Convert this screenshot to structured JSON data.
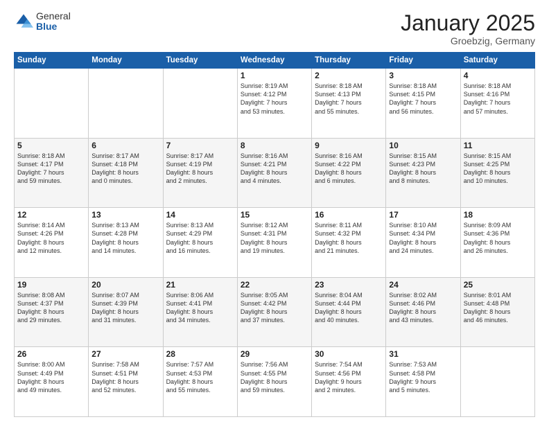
{
  "header": {
    "logo_general": "General",
    "logo_blue": "Blue",
    "month_title": "January 2025",
    "location": "Groebzig, Germany"
  },
  "weekdays": [
    "Sunday",
    "Monday",
    "Tuesday",
    "Wednesday",
    "Thursday",
    "Friday",
    "Saturday"
  ],
  "weeks": [
    [
      {
        "day": "",
        "info": ""
      },
      {
        "day": "",
        "info": ""
      },
      {
        "day": "",
        "info": ""
      },
      {
        "day": "1",
        "info": "Sunrise: 8:19 AM\nSunset: 4:12 PM\nDaylight: 7 hours\nand 53 minutes."
      },
      {
        "day": "2",
        "info": "Sunrise: 8:18 AM\nSunset: 4:13 PM\nDaylight: 7 hours\nand 55 minutes."
      },
      {
        "day": "3",
        "info": "Sunrise: 8:18 AM\nSunset: 4:15 PM\nDaylight: 7 hours\nand 56 minutes."
      },
      {
        "day": "4",
        "info": "Sunrise: 8:18 AM\nSunset: 4:16 PM\nDaylight: 7 hours\nand 57 minutes."
      }
    ],
    [
      {
        "day": "5",
        "info": "Sunrise: 8:18 AM\nSunset: 4:17 PM\nDaylight: 7 hours\nand 59 minutes."
      },
      {
        "day": "6",
        "info": "Sunrise: 8:17 AM\nSunset: 4:18 PM\nDaylight: 8 hours\nand 0 minutes."
      },
      {
        "day": "7",
        "info": "Sunrise: 8:17 AM\nSunset: 4:19 PM\nDaylight: 8 hours\nand 2 minutes."
      },
      {
        "day": "8",
        "info": "Sunrise: 8:16 AM\nSunset: 4:21 PM\nDaylight: 8 hours\nand 4 minutes."
      },
      {
        "day": "9",
        "info": "Sunrise: 8:16 AM\nSunset: 4:22 PM\nDaylight: 8 hours\nand 6 minutes."
      },
      {
        "day": "10",
        "info": "Sunrise: 8:15 AM\nSunset: 4:23 PM\nDaylight: 8 hours\nand 8 minutes."
      },
      {
        "day": "11",
        "info": "Sunrise: 8:15 AM\nSunset: 4:25 PM\nDaylight: 8 hours\nand 10 minutes."
      }
    ],
    [
      {
        "day": "12",
        "info": "Sunrise: 8:14 AM\nSunset: 4:26 PM\nDaylight: 8 hours\nand 12 minutes."
      },
      {
        "day": "13",
        "info": "Sunrise: 8:13 AM\nSunset: 4:28 PM\nDaylight: 8 hours\nand 14 minutes."
      },
      {
        "day": "14",
        "info": "Sunrise: 8:13 AM\nSunset: 4:29 PM\nDaylight: 8 hours\nand 16 minutes."
      },
      {
        "day": "15",
        "info": "Sunrise: 8:12 AM\nSunset: 4:31 PM\nDaylight: 8 hours\nand 19 minutes."
      },
      {
        "day": "16",
        "info": "Sunrise: 8:11 AM\nSunset: 4:32 PM\nDaylight: 8 hours\nand 21 minutes."
      },
      {
        "day": "17",
        "info": "Sunrise: 8:10 AM\nSunset: 4:34 PM\nDaylight: 8 hours\nand 24 minutes."
      },
      {
        "day": "18",
        "info": "Sunrise: 8:09 AM\nSunset: 4:36 PM\nDaylight: 8 hours\nand 26 minutes."
      }
    ],
    [
      {
        "day": "19",
        "info": "Sunrise: 8:08 AM\nSunset: 4:37 PM\nDaylight: 8 hours\nand 29 minutes."
      },
      {
        "day": "20",
        "info": "Sunrise: 8:07 AM\nSunset: 4:39 PM\nDaylight: 8 hours\nand 31 minutes."
      },
      {
        "day": "21",
        "info": "Sunrise: 8:06 AM\nSunset: 4:41 PM\nDaylight: 8 hours\nand 34 minutes."
      },
      {
        "day": "22",
        "info": "Sunrise: 8:05 AM\nSunset: 4:42 PM\nDaylight: 8 hours\nand 37 minutes."
      },
      {
        "day": "23",
        "info": "Sunrise: 8:04 AM\nSunset: 4:44 PM\nDaylight: 8 hours\nand 40 minutes."
      },
      {
        "day": "24",
        "info": "Sunrise: 8:02 AM\nSunset: 4:46 PM\nDaylight: 8 hours\nand 43 minutes."
      },
      {
        "day": "25",
        "info": "Sunrise: 8:01 AM\nSunset: 4:48 PM\nDaylight: 8 hours\nand 46 minutes."
      }
    ],
    [
      {
        "day": "26",
        "info": "Sunrise: 8:00 AM\nSunset: 4:49 PM\nDaylight: 8 hours\nand 49 minutes."
      },
      {
        "day": "27",
        "info": "Sunrise: 7:58 AM\nSunset: 4:51 PM\nDaylight: 8 hours\nand 52 minutes."
      },
      {
        "day": "28",
        "info": "Sunrise: 7:57 AM\nSunset: 4:53 PM\nDaylight: 8 hours\nand 55 minutes."
      },
      {
        "day": "29",
        "info": "Sunrise: 7:56 AM\nSunset: 4:55 PM\nDaylight: 8 hours\nand 59 minutes."
      },
      {
        "day": "30",
        "info": "Sunrise: 7:54 AM\nSunset: 4:56 PM\nDaylight: 9 hours\nand 2 minutes."
      },
      {
        "day": "31",
        "info": "Sunrise: 7:53 AM\nSunset: 4:58 PM\nDaylight: 9 hours\nand 5 minutes."
      },
      {
        "day": "",
        "info": ""
      }
    ]
  ]
}
